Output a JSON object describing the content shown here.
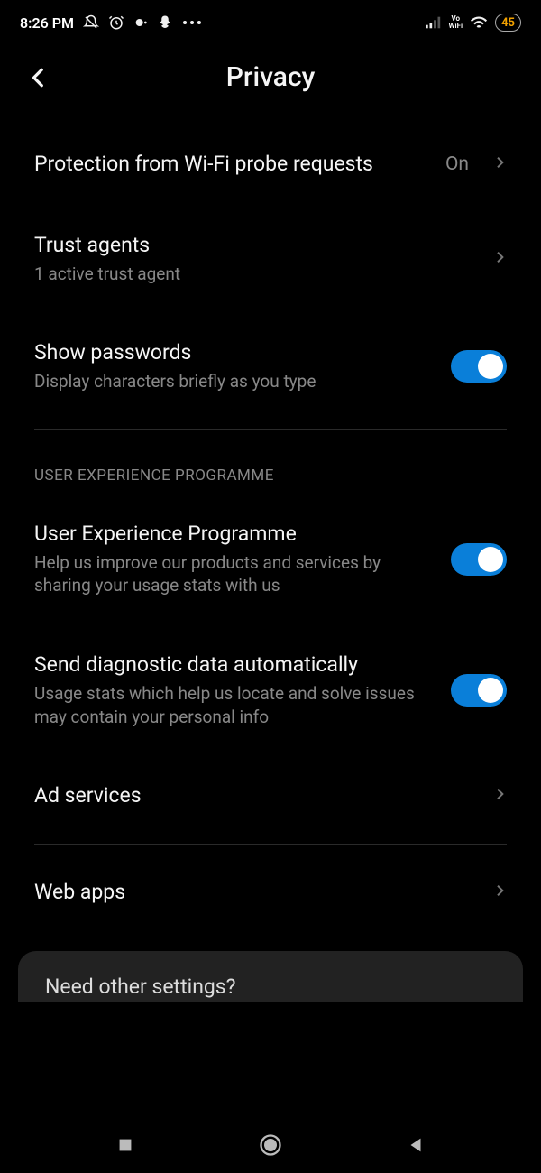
{
  "status": {
    "time": "8:26 PM",
    "battery": "45",
    "vo": "Vo",
    "wifi_label": "WiFi"
  },
  "header": {
    "title": "Privacy"
  },
  "rows": {
    "wifi_probe": {
      "title": "Protection from Wi-Fi probe requests",
      "value": "On"
    },
    "trust_agents": {
      "title": "Trust agents",
      "sub": "1 active trust agent"
    },
    "show_passwords": {
      "title": "Show passwords",
      "sub": "Display characters briefly as you type"
    }
  },
  "section": {
    "uep_header": "USER EXPERIENCE PROGRAMME",
    "uep": {
      "title": "User Experience Programme",
      "sub": "Help us improve our products and services by sharing your usage stats with us"
    },
    "diag": {
      "title": "Send diagnostic data automatically",
      "sub": "Usage stats which help us locate and solve issues may contain your personal info"
    },
    "ad": {
      "title": "Ad services"
    },
    "web": {
      "title": "Web apps"
    }
  },
  "suggestion": {
    "title": "Need other settings?"
  },
  "toggles": {
    "show_passwords": true,
    "uep": true,
    "diag": true
  }
}
